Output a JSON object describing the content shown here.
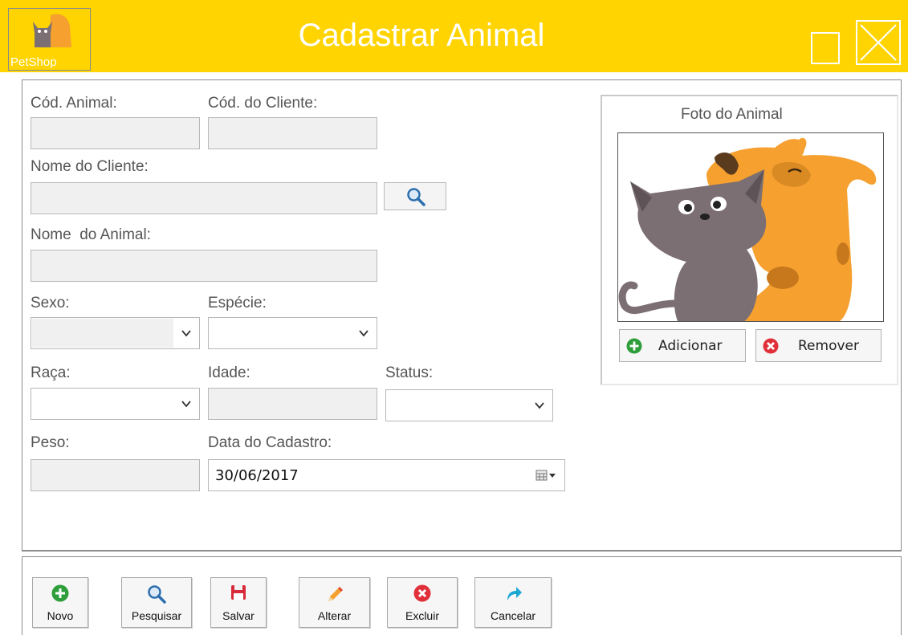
{
  "window": {
    "title": "Cadastrar Animal",
    "logo_text": "PetShop"
  },
  "form": {
    "cod_animal": {
      "label": "Cód. Animal:",
      "value": ""
    },
    "cod_cliente": {
      "label": "Cód. do Cliente:",
      "value": ""
    },
    "nome_cliente": {
      "label": "Nome do Cliente:",
      "value": ""
    },
    "nome_animal": {
      "label": "Nome  do Animal:",
      "value": ""
    },
    "sexo": {
      "label": "Sexo:",
      "value": ""
    },
    "especie": {
      "label": "Espécie:",
      "value": ""
    },
    "raca": {
      "label": "Raça:",
      "value": ""
    },
    "idade": {
      "label": "Idade:",
      "value": ""
    },
    "status": {
      "label": "Status:",
      "value": ""
    },
    "peso": {
      "label": "Peso:",
      "value": ""
    },
    "data_cadastro": {
      "label": "Data do Cadastro:",
      "value": "30/06/2017"
    }
  },
  "photo": {
    "title": "Foto do Animal",
    "add_label": "Adicionar",
    "remove_label": "Remover"
  },
  "toolbar": {
    "novo": "Novo",
    "pesquisar": "Pesquisar",
    "salvar": "Salvar",
    "alterar": "Alterar",
    "excluir": "Excluir",
    "cancelar": "Cancelar"
  },
  "colors": {
    "titlebar": "#ffd400",
    "add_green": "#2e9e3a",
    "remove_red": "#e0313a",
    "cat_gray": "#7b6f73",
    "dog_orange": "#f5a02f"
  }
}
